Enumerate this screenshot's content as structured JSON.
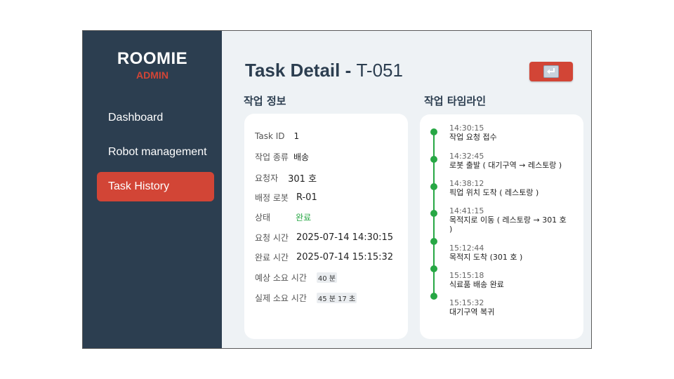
{
  "sidebar": {
    "brand": "ROOMIE",
    "brand_sub": "ADMIN",
    "items": [
      {
        "label": "Dashboard"
      },
      {
        "label": "Robot management"
      },
      {
        "label": "Task History"
      }
    ]
  },
  "header": {
    "title_prefix": "Task Detail - ",
    "task_id": "T-051",
    "back_icon": "return-arrow-icon"
  },
  "info": {
    "section_title": "작업 정보",
    "rows": [
      {
        "label": "Task ID",
        "value": "1"
      },
      {
        "label": "작업 종류",
        "value": "배송"
      },
      {
        "label": "요청자",
        "value": "301 호"
      },
      {
        "label": "배정 로봇",
        "value": "R-01"
      },
      {
        "label": "상태",
        "value": "완료"
      },
      {
        "label": "요청 시간",
        "value": "2025-07-14 14:30:15"
      },
      {
        "label": "완료 시간",
        "value": "2025-07-14 15:15:32"
      },
      {
        "label": "예상 소요 시간",
        "value": "40 분"
      },
      {
        "label": "실제 소요 시간",
        "value": "45 분 17 초"
      }
    ]
  },
  "timeline": {
    "section_title": "작업 타임라인",
    "events": [
      {
        "time": "14:30:15",
        "desc": "작업 요청 접수"
      },
      {
        "time": "14:32:45",
        "desc": "로봇 출발 ( 대기구역 → 레스토랑 )"
      },
      {
        "time": "14:38:12",
        "desc": "픽업 위치 도착 ( 레스토랑 )"
      },
      {
        "time": "14:41:15",
        "desc": "목적지로 이동 ( 레스토랑 →  301 호 )"
      },
      {
        "time": "15:12:44",
        "desc": "목적지 도착 (301 호 )"
      },
      {
        "time": "15:15:18",
        "desc": "식료품 배송 완료"
      },
      {
        "time": "15:15:32",
        "desc": "대기구역 복귀"
      }
    ]
  },
  "colors": {
    "sidebar_bg": "#2c3e50",
    "accent": "#d24536",
    "success": "#28a745",
    "main_bg": "#eef2f5"
  }
}
